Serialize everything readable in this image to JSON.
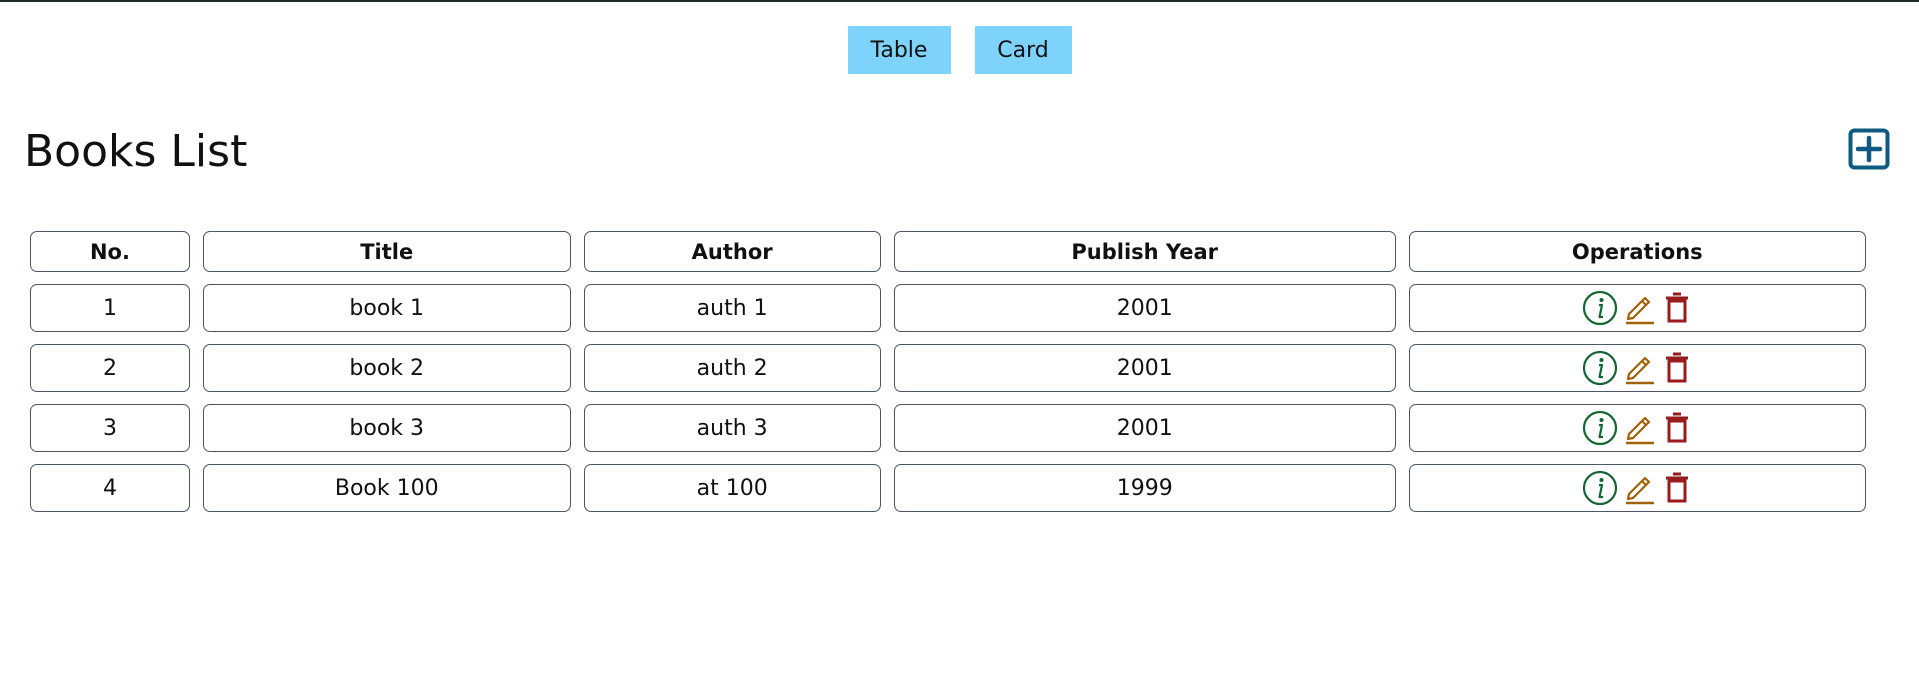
{
  "view_toggle": {
    "table_label": "Table",
    "card_label": "Card",
    "color": "#7dd3fc"
  },
  "page": {
    "title": "Books List",
    "add_icon": "plus-square-icon",
    "add_icon_color": "#0e5a80"
  },
  "table": {
    "headers": {
      "no": "No.",
      "title": "Title",
      "author": "Author",
      "publish_year": "Publish Year",
      "operations": "Operations"
    },
    "rows": [
      {
        "no": "1",
        "title": "book 1",
        "author": "auth 1",
        "publish_year": "2001"
      },
      {
        "no": "2",
        "title": "book 2",
        "author": "auth 2",
        "publish_year": "2001"
      },
      {
        "no": "3",
        "title": "book 3",
        "author": "auth 3",
        "publish_year": "2001"
      },
      {
        "no": "4",
        "title": "Book 100",
        "author": "at 100",
        "publish_year": "1999"
      }
    ],
    "operation_icons": [
      {
        "name": "info-circle-icon",
        "color": "#166534"
      },
      {
        "name": "pencil-edit-icon",
        "color": "#a16207"
      },
      {
        "name": "trash-icon",
        "color": "#991b1b"
      }
    ]
  }
}
